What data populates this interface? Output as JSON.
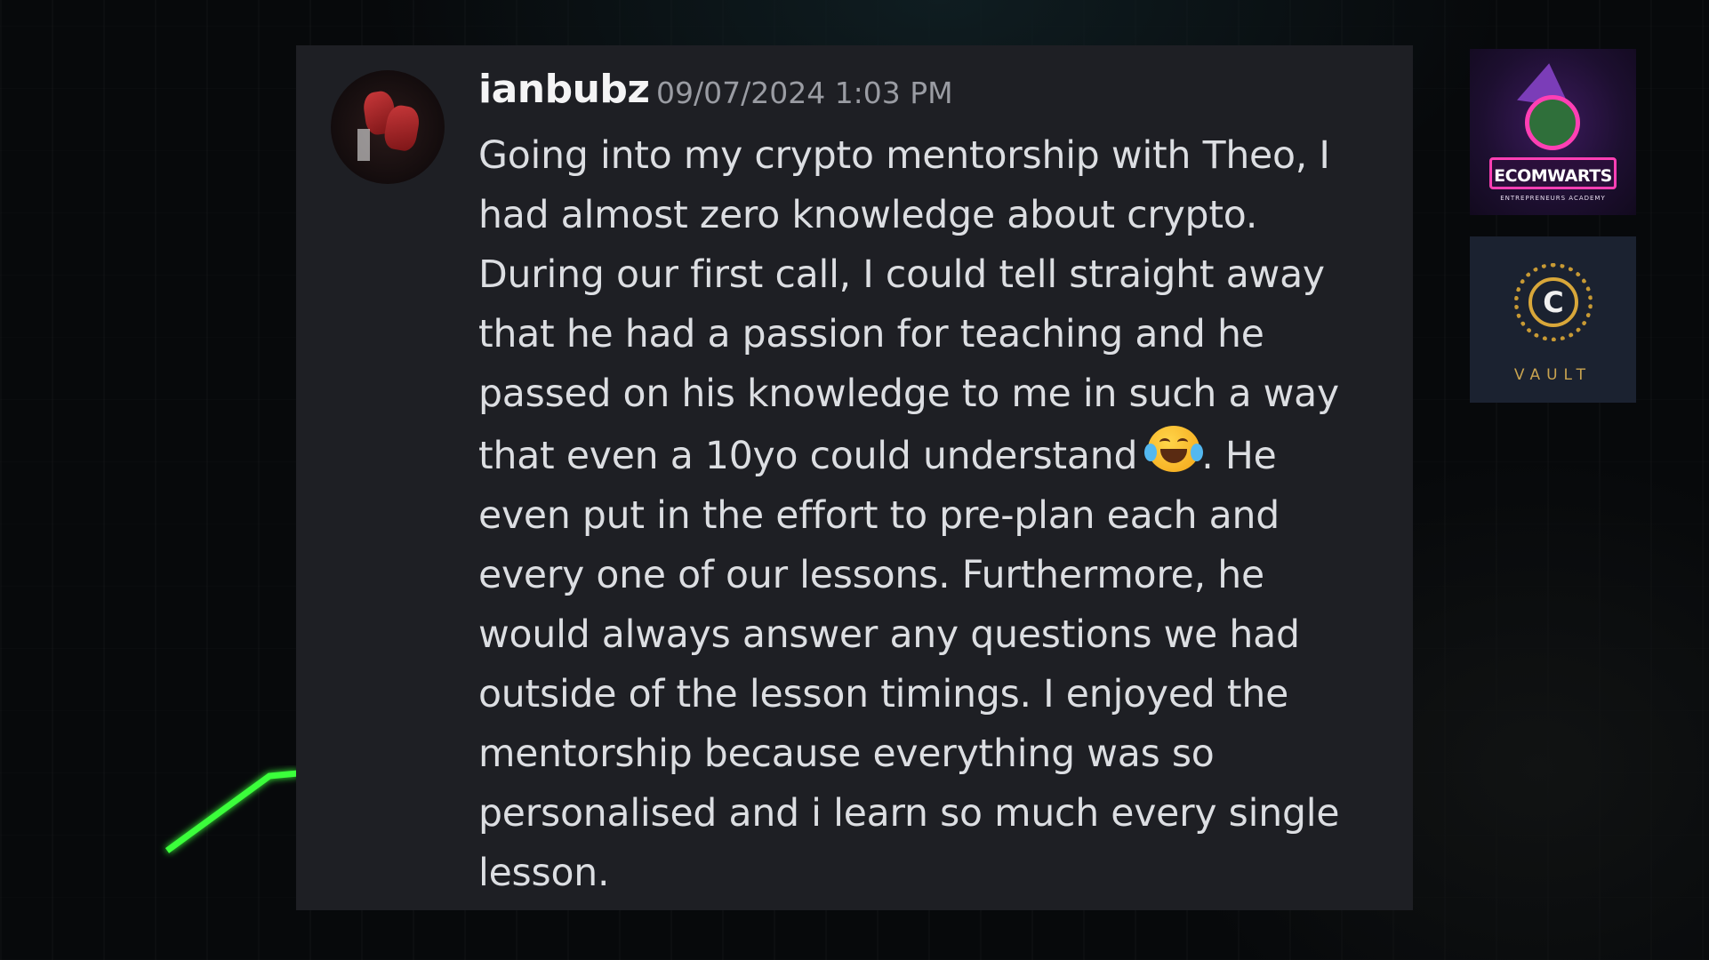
{
  "message": {
    "username": "ianbubz",
    "timestamp": "09/07/2024 1:03 PM",
    "text_before_emoji": "Going into my crypto mentorship with Theo, I had almost zero knowledge about crypto. During our first call, I could tell straight away that he had a passion for teaching and he passed on his knowledge to me in such a way that even a 10yo could understand",
    "emoji": "face-with-tears-of-joy-icon",
    "text_after_emoji": ". He even put in the effort to pre-plan each and every one of our lessons. Furthermore, he would always answer any questions we had outside of the lesson timings. I enjoyed the mentorship because everything was so personalised and i learn so much every single lesson."
  },
  "logos": {
    "ecomwarts": {
      "title": "ECOMWARTS",
      "subtitle": "ENTREPRENEURS ACADEMY"
    },
    "vault": {
      "letter": "C",
      "label": "VAULT"
    }
  },
  "colors": {
    "card_background": "#1e1f24",
    "accent_green": "#3bff3b",
    "ecom_pink": "#ff3fb4",
    "vault_gold": "#c9a450"
  }
}
